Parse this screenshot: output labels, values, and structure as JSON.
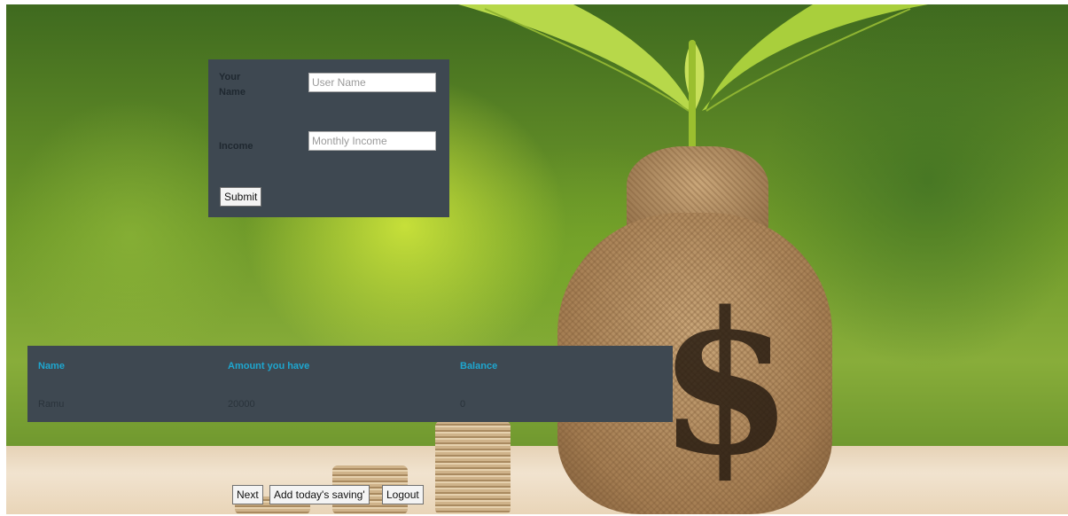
{
  "form": {
    "name_label": "Your Name",
    "name_placeholder": "User Name",
    "name_value": "",
    "income_label": "Income",
    "income_placeholder": "Monthly Income",
    "income_value": "",
    "submit_label": "Submit"
  },
  "table": {
    "headers": [
      "Name",
      "Amount you have",
      "Balance"
    ],
    "rows": [
      [
        "Ramu",
        "20000",
        "0"
      ]
    ]
  },
  "actions": {
    "next_label": "Next",
    "add_saving_label": "Add today's saving'",
    "logout_label": "Logout"
  },
  "icons": {
    "background": "money-bag-plant-image"
  },
  "colors": {
    "panel_bg": "#3e4851",
    "header_text": "#1ea6cf"
  }
}
